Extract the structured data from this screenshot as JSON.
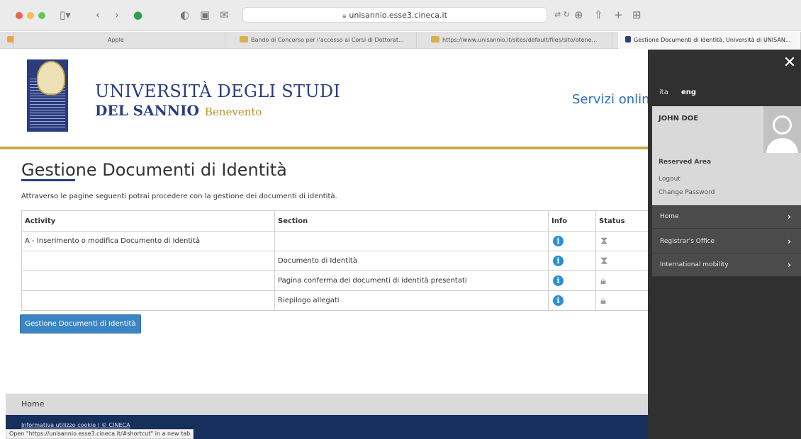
{
  "browser": {
    "url": "unisannio.esse3.cineca.it",
    "tabs": [
      "Apple",
      "Bando di Concorso per l'accesso ai Corsi di Dottorat...",
      "https://www.unisannio.it/sites/default/files/sito/atene...",
      "Gestione Documenti di Identità, Università di UNISAN..."
    ]
  },
  "header": {
    "university_line1": "UNIVERSITÀ DEGLI STUDI",
    "university_line2": "DEL SANNIO",
    "city": "Benevento",
    "servizi": "Servizi online"
  },
  "main": {
    "title": "Gestione Documenti di Identità",
    "intro": "Attraverso le pagine seguenti potrai procedere con la gestione dei documenti di identità.",
    "table": {
      "headers": [
        "Activity",
        "Section",
        "Info",
        "Status"
      ],
      "rows": [
        {
          "activity": "A - Inserimento o modifica Documento di Identità",
          "section": "",
          "status": "hourglass"
        },
        {
          "activity": "",
          "section": "Documento di Identità",
          "status": "hourglass"
        },
        {
          "activity": "",
          "section": "Pagina conferma dei documenti di identità presentati",
          "status": "lock"
        },
        {
          "activity": "",
          "section": "Riepilogo allegati",
          "status": "lock"
        }
      ]
    },
    "button_label": "Gestione Documenti di Identità"
  },
  "footer": {
    "home": "Home",
    "bottom": "Informativa utilizzo cookie | © CINECA",
    "status_url": "Open \"https://unisannio.esse3.cineca.it/#shortcut\" in a new tab"
  },
  "panel": {
    "lang_ita": "ita",
    "lang_eng": "eng",
    "user_name": "JOHN DOE",
    "reserved": "Reserved Area",
    "logout": "Logout",
    "change_password": "Change Password",
    "menu": [
      "Home",
      "Registrar's Office",
      "International mobility"
    ]
  },
  "colors": {
    "brand_blue": "#2a3d7e",
    "gold": "#c9a84f",
    "info_blue": "#2a8fd6",
    "panel_dark": "#303030"
  }
}
